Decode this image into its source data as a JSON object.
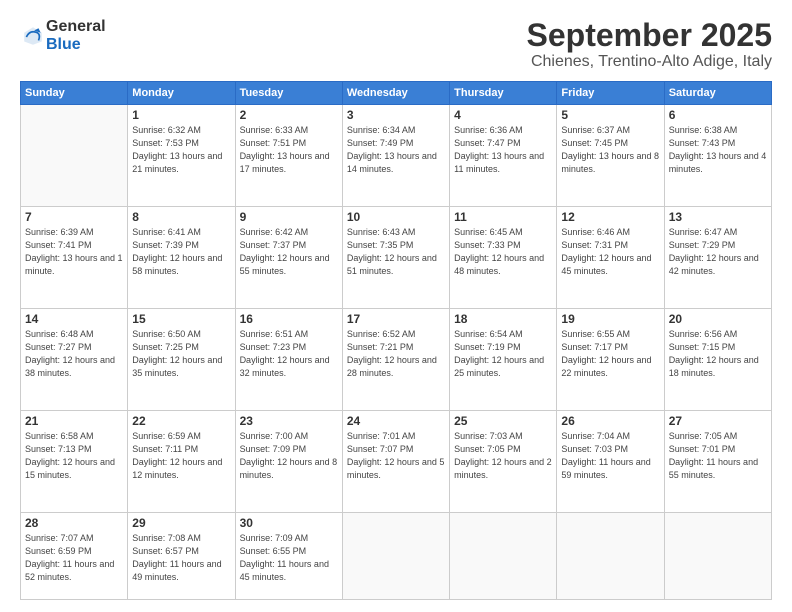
{
  "logo": {
    "general": "General",
    "blue": "Blue"
  },
  "title": "September 2025",
  "location": "Chienes, Trentino-Alto Adige, Italy",
  "weekdays": [
    "Sunday",
    "Monday",
    "Tuesday",
    "Wednesday",
    "Thursday",
    "Friday",
    "Saturday"
  ],
  "days": [
    {
      "date": "",
      "sunrise": "",
      "sunset": "",
      "daylight": ""
    },
    {
      "date": "1",
      "sunrise": "Sunrise: 6:32 AM",
      "sunset": "Sunset: 7:53 PM",
      "daylight": "Daylight: 13 hours and 21 minutes."
    },
    {
      "date": "2",
      "sunrise": "Sunrise: 6:33 AM",
      "sunset": "Sunset: 7:51 PM",
      "daylight": "Daylight: 13 hours and 17 minutes."
    },
    {
      "date": "3",
      "sunrise": "Sunrise: 6:34 AM",
      "sunset": "Sunset: 7:49 PM",
      "daylight": "Daylight: 13 hours and 14 minutes."
    },
    {
      "date": "4",
      "sunrise": "Sunrise: 6:36 AM",
      "sunset": "Sunset: 7:47 PM",
      "daylight": "Daylight: 13 hours and 11 minutes."
    },
    {
      "date": "5",
      "sunrise": "Sunrise: 6:37 AM",
      "sunset": "Sunset: 7:45 PM",
      "daylight": "Daylight: 13 hours and 8 minutes."
    },
    {
      "date": "6",
      "sunrise": "Sunrise: 6:38 AM",
      "sunset": "Sunset: 7:43 PM",
      "daylight": "Daylight: 13 hours and 4 minutes."
    },
    {
      "date": "7",
      "sunrise": "Sunrise: 6:39 AM",
      "sunset": "Sunset: 7:41 PM",
      "daylight": "Daylight: 13 hours and 1 minute."
    },
    {
      "date": "8",
      "sunrise": "Sunrise: 6:41 AM",
      "sunset": "Sunset: 7:39 PM",
      "daylight": "Daylight: 12 hours and 58 minutes."
    },
    {
      "date": "9",
      "sunrise": "Sunrise: 6:42 AM",
      "sunset": "Sunset: 7:37 PM",
      "daylight": "Daylight: 12 hours and 55 minutes."
    },
    {
      "date": "10",
      "sunrise": "Sunrise: 6:43 AM",
      "sunset": "Sunset: 7:35 PM",
      "daylight": "Daylight: 12 hours and 51 minutes."
    },
    {
      "date": "11",
      "sunrise": "Sunrise: 6:45 AM",
      "sunset": "Sunset: 7:33 PM",
      "daylight": "Daylight: 12 hours and 48 minutes."
    },
    {
      "date": "12",
      "sunrise": "Sunrise: 6:46 AM",
      "sunset": "Sunset: 7:31 PM",
      "daylight": "Daylight: 12 hours and 45 minutes."
    },
    {
      "date": "13",
      "sunrise": "Sunrise: 6:47 AM",
      "sunset": "Sunset: 7:29 PM",
      "daylight": "Daylight: 12 hours and 42 minutes."
    },
    {
      "date": "14",
      "sunrise": "Sunrise: 6:48 AM",
      "sunset": "Sunset: 7:27 PM",
      "daylight": "Daylight: 12 hours and 38 minutes."
    },
    {
      "date": "15",
      "sunrise": "Sunrise: 6:50 AM",
      "sunset": "Sunset: 7:25 PM",
      "daylight": "Daylight: 12 hours and 35 minutes."
    },
    {
      "date": "16",
      "sunrise": "Sunrise: 6:51 AM",
      "sunset": "Sunset: 7:23 PM",
      "daylight": "Daylight: 12 hours and 32 minutes."
    },
    {
      "date": "17",
      "sunrise": "Sunrise: 6:52 AM",
      "sunset": "Sunset: 7:21 PM",
      "daylight": "Daylight: 12 hours and 28 minutes."
    },
    {
      "date": "18",
      "sunrise": "Sunrise: 6:54 AM",
      "sunset": "Sunset: 7:19 PM",
      "daylight": "Daylight: 12 hours and 25 minutes."
    },
    {
      "date": "19",
      "sunrise": "Sunrise: 6:55 AM",
      "sunset": "Sunset: 7:17 PM",
      "daylight": "Daylight: 12 hours and 22 minutes."
    },
    {
      "date": "20",
      "sunrise": "Sunrise: 6:56 AM",
      "sunset": "Sunset: 7:15 PM",
      "daylight": "Daylight: 12 hours and 18 minutes."
    },
    {
      "date": "21",
      "sunrise": "Sunrise: 6:58 AM",
      "sunset": "Sunset: 7:13 PM",
      "daylight": "Daylight: 12 hours and 15 minutes."
    },
    {
      "date": "22",
      "sunrise": "Sunrise: 6:59 AM",
      "sunset": "Sunset: 7:11 PM",
      "daylight": "Daylight: 12 hours and 12 minutes."
    },
    {
      "date": "23",
      "sunrise": "Sunrise: 7:00 AM",
      "sunset": "Sunset: 7:09 PM",
      "daylight": "Daylight: 12 hours and 8 minutes."
    },
    {
      "date": "24",
      "sunrise": "Sunrise: 7:01 AM",
      "sunset": "Sunset: 7:07 PM",
      "daylight": "Daylight: 12 hours and 5 minutes."
    },
    {
      "date": "25",
      "sunrise": "Sunrise: 7:03 AM",
      "sunset": "Sunset: 7:05 PM",
      "daylight": "Daylight: 12 hours and 2 minutes."
    },
    {
      "date": "26",
      "sunrise": "Sunrise: 7:04 AM",
      "sunset": "Sunset: 7:03 PM",
      "daylight": "Daylight: 11 hours and 59 minutes."
    },
    {
      "date": "27",
      "sunrise": "Sunrise: 7:05 AM",
      "sunset": "Sunset: 7:01 PM",
      "daylight": "Daylight: 11 hours and 55 minutes."
    },
    {
      "date": "28",
      "sunrise": "Sunrise: 7:07 AM",
      "sunset": "Sunset: 6:59 PM",
      "daylight": "Daylight: 11 hours and 52 minutes."
    },
    {
      "date": "29",
      "sunrise": "Sunrise: 7:08 AM",
      "sunset": "Sunset: 6:57 PM",
      "daylight": "Daylight: 11 hours and 49 minutes."
    },
    {
      "date": "30",
      "sunrise": "Sunrise: 7:09 AM",
      "sunset": "Sunset: 6:55 PM",
      "daylight": "Daylight: 11 hours and 45 minutes."
    },
    {
      "date": "",
      "sunrise": "",
      "sunset": "",
      "daylight": ""
    },
    {
      "date": "",
      "sunrise": "",
      "sunset": "",
      "daylight": ""
    },
    {
      "date": "",
      "sunrise": "",
      "sunset": "",
      "daylight": ""
    },
    {
      "date": "",
      "sunrise": "",
      "sunset": "",
      "daylight": ""
    }
  ]
}
